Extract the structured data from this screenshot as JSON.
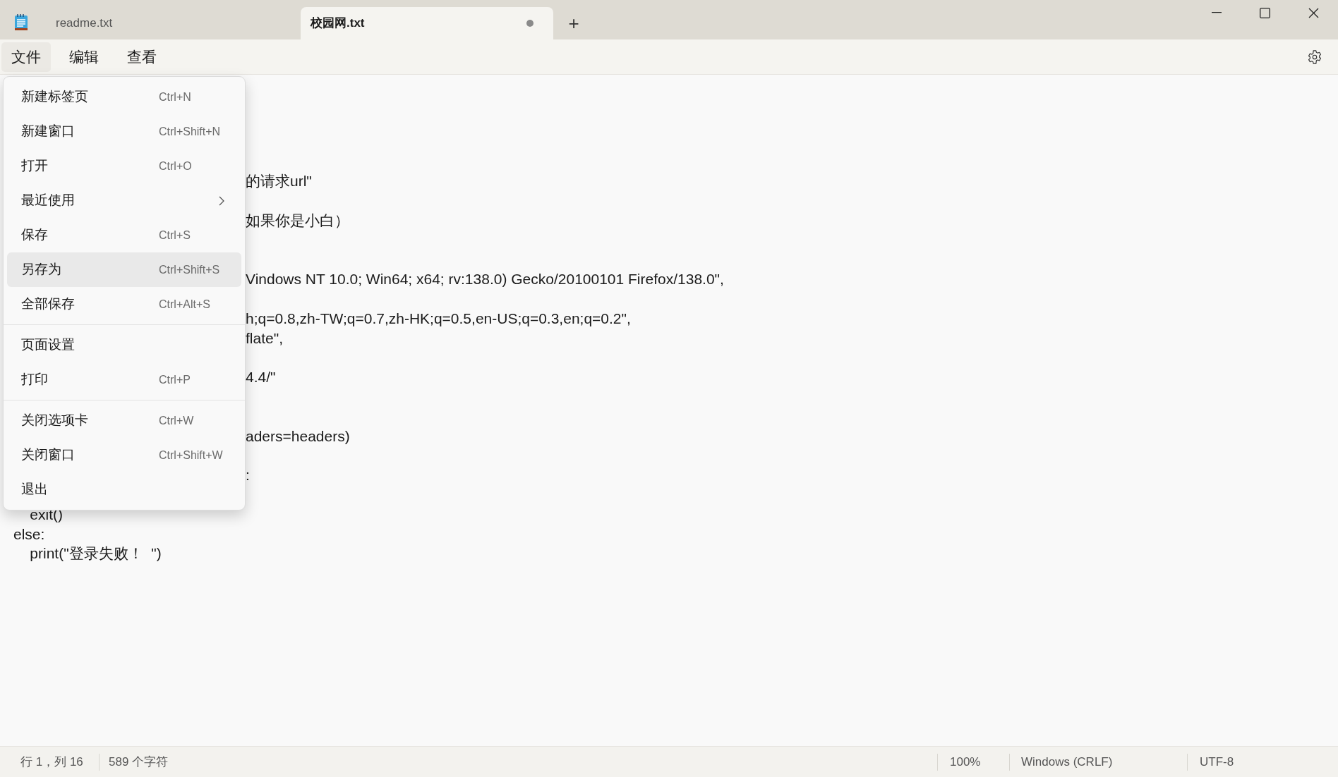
{
  "tabs": [
    {
      "label": "readme.txt",
      "selected": false,
      "modified": false
    },
    {
      "label": "校园网.txt",
      "selected": true,
      "modified": true
    }
  ],
  "new_tab_button": "+",
  "menu_bar": [
    {
      "label": "文件",
      "selected": true
    },
    {
      "label": "编辑",
      "selected": false
    },
    {
      "label": "查看",
      "selected": false
    }
  ],
  "file_menu": [
    {
      "kind": "item",
      "label": "新建标签页",
      "shortcut": "Ctrl+N",
      "selected": false
    },
    {
      "kind": "item",
      "label": "新建窗口",
      "shortcut": "Ctrl+Shift+N",
      "selected": false
    },
    {
      "kind": "item",
      "label": "打开",
      "shortcut": "Ctrl+O",
      "selected": false
    },
    {
      "kind": "submenu",
      "label": "最近使用",
      "selected": false
    },
    {
      "kind": "item",
      "label": "保存",
      "shortcut": "Ctrl+S",
      "selected": false
    },
    {
      "kind": "item",
      "label": "另存为",
      "shortcut": "Ctrl+Shift+S",
      "selected": true
    },
    {
      "kind": "item",
      "label": "全部保存",
      "shortcut": "Ctrl+Alt+S",
      "selected": false
    },
    {
      "kind": "separator"
    },
    {
      "kind": "item",
      "label": "页面设置",
      "selected": false
    },
    {
      "kind": "item",
      "label": "打印",
      "shortcut": "Ctrl+P",
      "selected": false
    },
    {
      "kind": "separator"
    },
    {
      "kind": "item",
      "label": "关闭选项卡",
      "shortcut": "Ctrl+W",
      "selected": false
    },
    {
      "kind": "item",
      "label": "关闭窗口",
      "shortcut": "Ctrl+Shift+W",
      "selected": false
    },
    {
      "kind": "item",
      "label": "退出",
      "selected": false
    }
  ],
  "editor_lines": [
    {
      "kind": "hidden"
    },
    {
      "kind": "hidden"
    },
    {
      "kind": "hidden"
    },
    {
      "kind": "hidden"
    },
    {
      "kind": "cut",
      "text": "的请求url\""
    },
    {
      "kind": "hidden"
    },
    {
      "kind": "cut",
      "text": "如果你是小白）"
    },
    {
      "kind": "hidden"
    },
    {
      "kind": "hidden"
    },
    {
      "kind": "cut",
      "text": "Vindows NT 10.0; Win64; x64; rv:138.0) Gecko/20100101 Firefox/138.0\","
    },
    {
      "kind": "hidden"
    },
    {
      "kind": "cut",
      "text": "h;q=0.8,zh-TW;q=0.7,zh-HK;q=0.5,en-US;q=0.3,en;q=0.2\","
    },
    {
      "kind": "cut",
      "text": "flate\","
    },
    {
      "kind": "hidden"
    },
    {
      "kind": "cut",
      "text": "4.4/\""
    },
    {
      "kind": "hidden"
    },
    {
      "kind": "hidden"
    },
    {
      "kind": "cut",
      "text": "aders=headers)"
    },
    {
      "kind": "hidden"
    },
    {
      "kind": "cut",
      "text": ":"
    },
    {
      "kind": "hidden"
    },
    {
      "kind": "full",
      "text": "    exit()"
    },
    {
      "kind": "full",
      "text": "else:"
    },
    {
      "kind": "full",
      "text": "    print(\"登录失败！  \")"
    }
  ],
  "status_bar": {
    "position": "行 1，列 16",
    "characters": "589 个字符",
    "zoom": "100%",
    "line_ending": "Windows (CRLF)",
    "encoding": "UTF-8"
  }
}
